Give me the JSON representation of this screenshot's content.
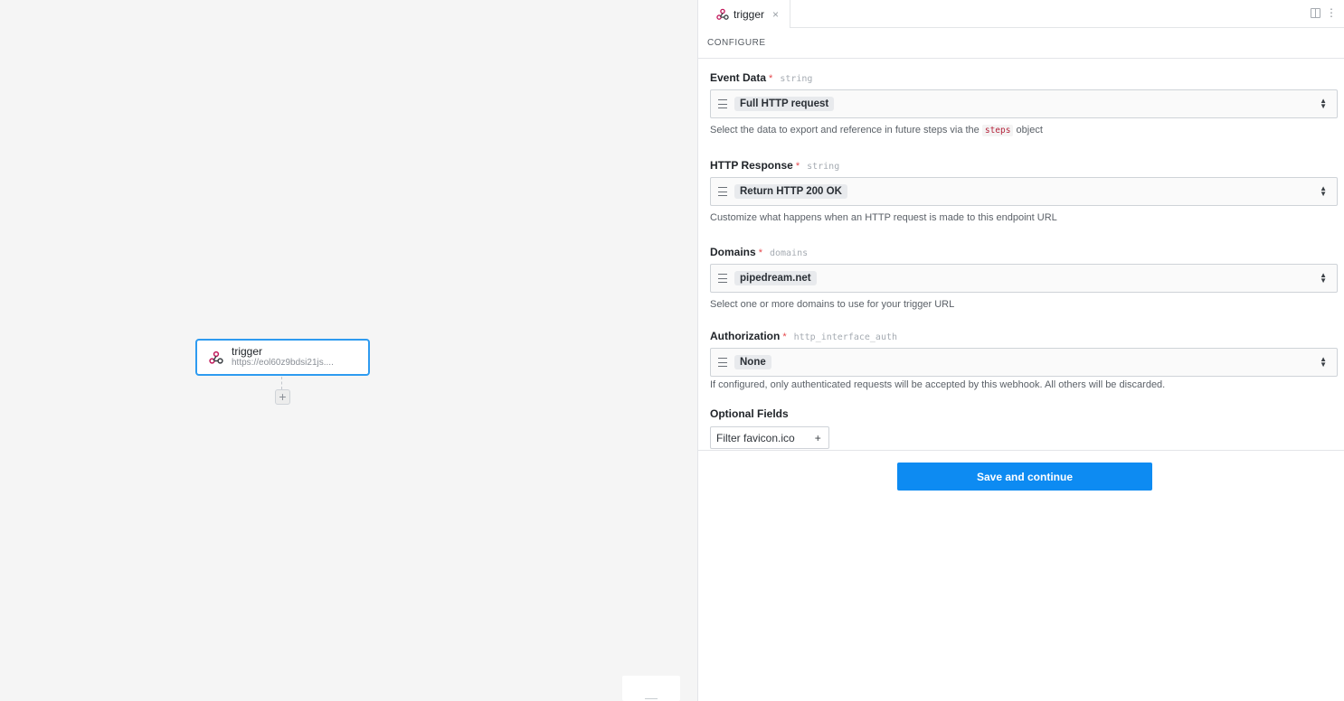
{
  "canvas": {
    "node": {
      "title": "trigger",
      "subtitle": "https://eol60z9bdsi21js....",
      "icon": "webhook-icon"
    },
    "add_step": "+"
  },
  "panel": {
    "tab": {
      "label": "trigger",
      "close": "×",
      "icon": "webhook-icon"
    },
    "section_title": "CONFIGURE",
    "fields": [
      {
        "label": "Event Data",
        "required": "*",
        "type": "string",
        "value": "Full HTTP request",
        "help_before": "Select the data to export and reference in future steps via the ",
        "help_code": "steps",
        "help_after": " object"
      },
      {
        "label": "HTTP Response",
        "required": "*",
        "type": "string",
        "value": "Return HTTP 200 OK",
        "help": "Customize what happens when an HTTP request is made to this endpoint URL"
      },
      {
        "label": "Domains",
        "required": "*",
        "type": "domains",
        "value": "pipedream.net",
        "help": "Select one or more domains to use for your trigger URL"
      },
      {
        "label": "Authorization",
        "required": "*",
        "type": "http_interface_auth",
        "value": "None",
        "help": "If configured, only authenticated requests will be accepted by this webhook. All others will be discarded."
      }
    ],
    "optional": {
      "label": "Optional Fields",
      "button": "Filter favicon.ico",
      "plus": "+"
    },
    "save_button": "Save and continue"
  },
  "colors": {
    "accent": "#0d8bf2",
    "node_border": "#2e9bf0",
    "required": "#e5484d",
    "webhook_icon": "#c2185b"
  }
}
